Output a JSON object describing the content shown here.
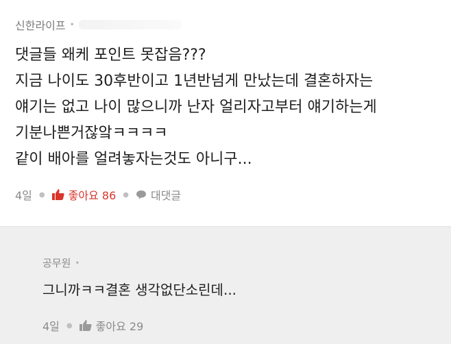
{
  "comment": {
    "author": "신한라이프",
    "author_separator": "•",
    "lines": [
      "댓글들 왜케 포인트 못잡음???",
      "지금 나이도 30후반이고 1년반넘게 만났는데 결혼하자는",
      "얘기는 없고 나이 많으니까 난자 얼리자고부터 얘기하는게",
      "기분나쁜거잖앜ㅋㅋㅋㅋ",
      "같이 배아를 얼려놓자는것도 아니구..."
    ],
    "time": "4일",
    "like_label": "좋아요 86",
    "reply_label": "대댓글",
    "like_color": "#d9352b"
  },
  "reply": {
    "author": "공무원",
    "author_separator": "•",
    "text": "그니까ㅋㅋ결혼 생각없단소린데...",
    "time": "4일",
    "like_label": "좋아요 29"
  },
  "icons": [
    "thumbs-up-icon",
    "speech-bubble-icon"
  ]
}
